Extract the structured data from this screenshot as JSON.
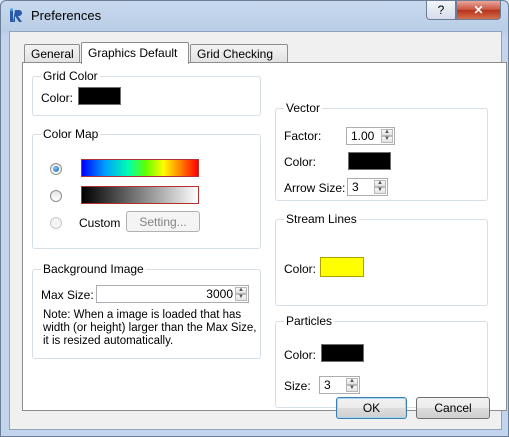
{
  "window": {
    "title": "Preferences",
    "help_label": "?",
    "close_label": "✕"
  },
  "tabs": [
    {
      "label": "General"
    },
    {
      "label": "Graphics Default"
    },
    {
      "label": "Grid Checking"
    }
  ],
  "grid_color": {
    "title": "Grid Color",
    "color_label": "Color:",
    "color": "#000000"
  },
  "color_map": {
    "title": "Color Map",
    "selected": "rainbow",
    "custom_label": "Custom",
    "setting_label": "Setting..."
  },
  "background_image": {
    "title": "Background Image",
    "max_size_label": "Max Size:",
    "max_size_value": "3000",
    "note": "Note: When a image is loaded that has width (or height) larger than the Max Size, it is resized automatically."
  },
  "vector": {
    "title": "Vector",
    "factor_label": "Factor:",
    "factor_value": "1.00",
    "color_label": "Color:",
    "color": "#000000",
    "arrow_size_label": "Arrow Size:",
    "arrow_size_value": "3"
  },
  "stream_lines": {
    "title": "Stream Lines",
    "color_label": "Color:",
    "color": "#ffff00"
  },
  "particles": {
    "title": "Particles",
    "color_label": "Color:",
    "color": "#000000",
    "size_label": "Size:",
    "size_value": "3"
  },
  "buttons": {
    "ok": "OK",
    "cancel": "Cancel"
  }
}
